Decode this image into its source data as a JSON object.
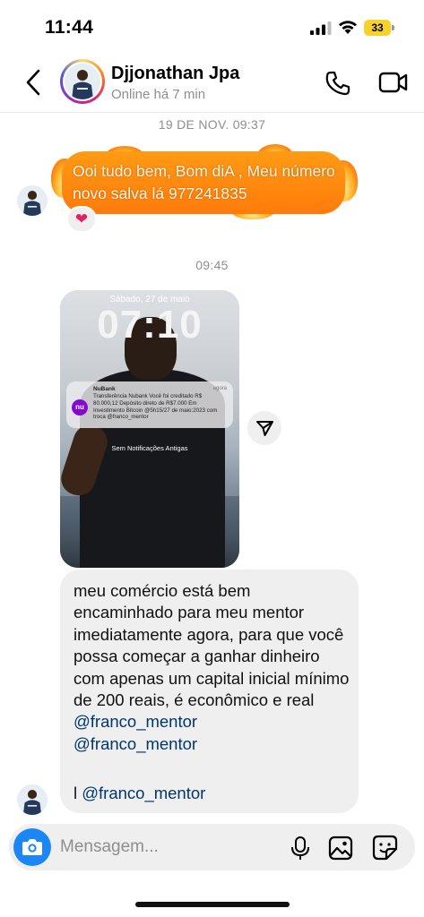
{
  "status_bar": {
    "time": "11:44",
    "battery": "33"
  },
  "header": {
    "contact_name": "Djjonathan Jpa",
    "contact_status": "Online há 7 min"
  },
  "messages": {
    "timestamp_1": "19 DE NOV. 09:37",
    "fire_message": "Ooi tudo bem,  Bom diA , Meu número novo salva lá 977241835",
    "reaction": "❤",
    "timestamp_2": "09:45",
    "photo": {
      "lock_date": "Sábado, 27 de maio",
      "lock_clock": "07:10",
      "notification_app": "NuBank",
      "notification_time": "agora",
      "notification_body": "Transferência Nubank Você foi creditado R$ 80.000,12 Depósito direto de R$7.000 Em Investimento Bitcoin @5h15/27 de maio:2023 com troca @franco_mentor",
      "notification_logo": "nu",
      "no_old_notifications": "Sem Notificações Antigas"
    },
    "text_message": {
      "body": "meu comércio está bem encaminhado para meu mentor imediatamente agora, para que você possa começar a ganhar dinheiro com apenas um capital inicial mínimo de 200 reais, é econômico e real ",
      "mention_1": "@franco_mentor",
      "mention_2": "@franco_mentor",
      "last_prefix": "l ",
      "mention_3": "@franco_mentor"
    }
  },
  "composer": {
    "placeholder": "Mensagem..."
  },
  "colors": {
    "camera_button": "#1b86f6",
    "mention": "#00376b",
    "fire_bubble": "#ff8a10"
  },
  "icons": {
    "back": "chevron-left-icon",
    "call": "phone-icon",
    "video": "video-camera-icon",
    "share": "send-icon",
    "camera": "camera-icon",
    "mic": "microphone-icon",
    "gallery": "image-icon",
    "sticker": "sticker-icon"
  }
}
